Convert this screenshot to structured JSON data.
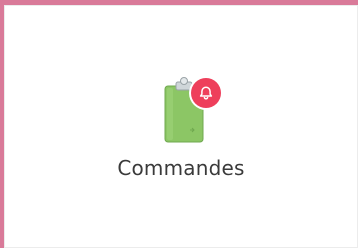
{
  "tile": {
    "label": "Commandes",
    "icon": "clipboard-icon",
    "badge_icon": "bell-icon",
    "colors": {
      "frame": "#d97a99",
      "clipboard": "#8cc665",
      "badge": "#ee3f5b",
      "text": "#3a3a3a"
    }
  }
}
